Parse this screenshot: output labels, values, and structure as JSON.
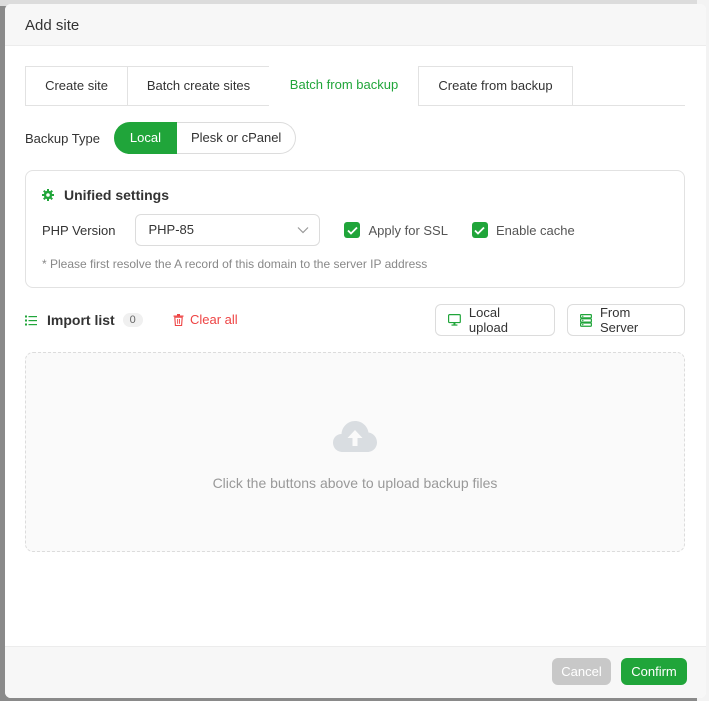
{
  "modal": {
    "title": "Add site"
  },
  "tabs": [
    {
      "label": "Create site",
      "active": false
    },
    {
      "label": "Batch create sites",
      "active": false
    },
    {
      "label": "Batch from backup",
      "active": true
    },
    {
      "label": "Create from backup",
      "active": false
    }
  ],
  "backup_type": {
    "label": "Backup Type",
    "options": [
      "Local",
      "Plesk or cPanel"
    ],
    "selected": "Local"
  },
  "settings": {
    "title": "Unified settings",
    "php_label": "PHP Version",
    "php_value": "PHP-85",
    "apply_ssl": {
      "label": "Apply for SSL",
      "checked": true
    },
    "enable_cache": {
      "label": "Enable cache",
      "checked": true
    },
    "note": "* Please first resolve the A record of this domain to the server IP address"
  },
  "import": {
    "title": "Import list",
    "count": "0",
    "clear_label": "Clear all",
    "local_upload_label": "Local upload",
    "from_server_label": "From Server"
  },
  "dropzone": {
    "text": "Click the buttons above to upload backup files"
  },
  "footer": {
    "cancel_label": "Cancel",
    "confirm_label": "Confirm"
  },
  "colors": {
    "accent": "#20a53a",
    "danger": "#e44444",
    "disabled": "#c8c8c8"
  }
}
